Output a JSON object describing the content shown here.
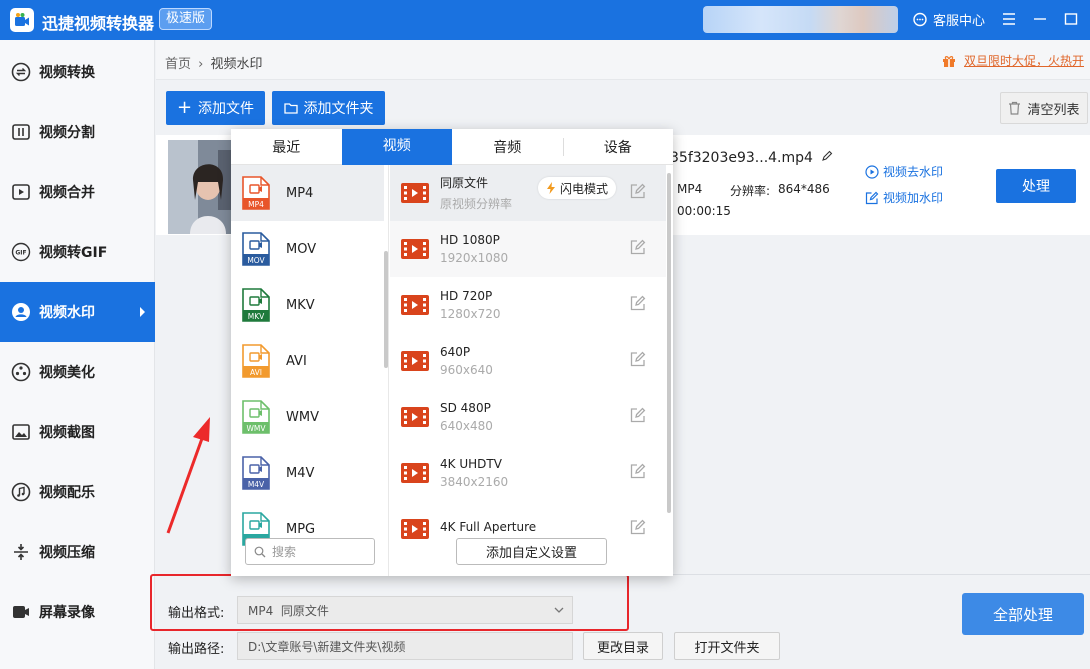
{
  "app": {
    "title": "迅捷视频转换器",
    "badge": "极速版",
    "service": "客服中心"
  },
  "sidebar": {
    "items": [
      {
        "label": "视频转换",
        "icon": "convert-icon"
      },
      {
        "label": "视频分割",
        "icon": "split-icon"
      },
      {
        "label": "视频合并",
        "icon": "merge-icon"
      },
      {
        "label": "视频转GIF",
        "icon": "gif-icon"
      },
      {
        "label": "视频水印",
        "icon": "watermark-icon",
        "active": true
      },
      {
        "label": "视频美化",
        "icon": "beautify-icon"
      },
      {
        "label": "视频截图",
        "icon": "screenshot-icon"
      },
      {
        "label": "视频配乐",
        "icon": "music-icon"
      },
      {
        "label": "视频压缩",
        "icon": "compress-icon"
      },
      {
        "label": "屏幕录像",
        "icon": "record-icon"
      }
    ]
  },
  "breadcrumb": {
    "home": "首页",
    "separator": "›",
    "current": "视频水印"
  },
  "promo": "双旦限时大促，火热开",
  "toolbar": {
    "add_file": "添加文件",
    "add_folder": "添加文件夹",
    "clear_list": "清空列表"
  },
  "file": {
    "name": "35f3203e93...4.mp4",
    "format": "MP4",
    "resolution_label": "分辨率:",
    "resolution": "864*486",
    "duration": "00:00:15",
    "remove_watermark": "视频去水印",
    "add_watermark": "视频加水印",
    "process": "处理"
  },
  "popup": {
    "tabs": [
      "最近",
      "视频",
      "音频",
      "设备"
    ],
    "active_tab": "视频",
    "formats": [
      {
        "name": "MP4",
        "tag": "MP4",
        "color": "#e8552a"
      },
      {
        "name": "MOV",
        "tag": "MOV",
        "color": "#2a5b9e"
      },
      {
        "name": "MKV",
        "tag": "MKV",
        "color": "#1f7a3c"
      },
      {
        "name": "AVI",
        "tag": "AVI",
        "color": "#f29a2e"
      },
      {
        "name": "WMV",
        "tag": "WMV",
        "color": "#6dbf6b"
      },
      {
        "name": "M4V",
        "tag": "M4V",
        "color": "#4a62a8"
      },
      {
        "name": "MPG",
        "tag": "",
        "color": "#2aa7a0"
      }
    ],
    "search_placeholder": "搜索",
    "presets": [
      {
        "name": "同原文件",
        "sub": "原视频分辨率"
      },
      {
        "name": "HD 1080P",
        "sub": "1920x1080"
      },
      {
        "name": "HD 720P",
        "sub": "1280x720"
      },
      {
        "name": "640P",
        "sub": "960x640"
      },
      {
        "name": "SD 480P",
        "sub": "640x480"
      },
      {
        "name": "4K UHDTV",
        "sub": "3840x2160"
      },
      {
        "name": "4K Full Aperture",
        "sub": ""
      }
    ],
    "flash_mode": "闪电模式",
    "custom_button": "添加自定义设置"
  },
  "bottom": {
    "format_label": "输出格式:",
    "format_value": "MP4  同原文件",
    "path_label": "输出路径:",
    "path_value": "D:\\文章账号\\新建文件夹\\视频",
    "change_dir": "更改目录",
    "open_folder": "打开文件夹",
    "process_all": "全部处理"
  },
  "colors": {
    "accent": "#1a72e0",
    "highlight_box": "#e8262b",
    "promo": "#e0662a"
  }
}
